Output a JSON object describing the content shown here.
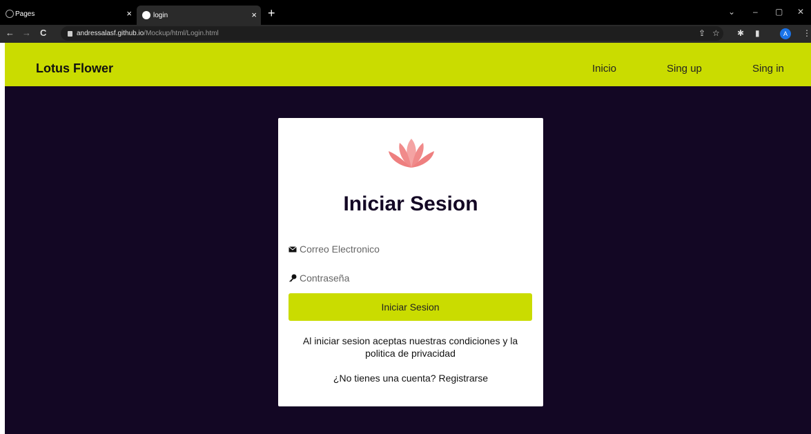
{
  "browser": {
    "tabs": [
      {
        "title": "Pages",
        "active": false
      },
      {
        "title": "login",
        "active": true
      }
    ],
    "new_tab": "+",
    "url_host": "andressalasf.github.io",
    "url_path": "/Mockup/html/Login.html",
    "profile_initial": "A",
    "controls": {
      "dropdown": "⌄",
      "minimize": "–",
      "restore": "▢",
      "close": "✕"
    },
    "nav": {
      "back": "←",
      "forward": "→",
      "reload": "C"
    }
  },
  "site": {
    "brand": "Lotus Flower",
    "nav": [
      {
        "label": "Inicio"
      },
      {
        "label": "Sing up"
      },
      {
        "label": "Sing in"
      }
    ],
    "colors": {
      "accent": "#cadc00",
      "background": "#130724",
      "lotus": "#f08a8a"
    }
  },
  "login": {
    "title": "Iniciar Sesion",
    "email_placeholder": "Correo Electronico",
    "password_placeholder": "Contraseña",
    "submit_label": "Iniciar Sesion",
    "terms": "Al iniciar sesion aceptas nuestras condiciones y la politica de privacidad",
    "no_account": "¿No tienes una cuenta?",
    "register": "Registrarse"
  }
}
